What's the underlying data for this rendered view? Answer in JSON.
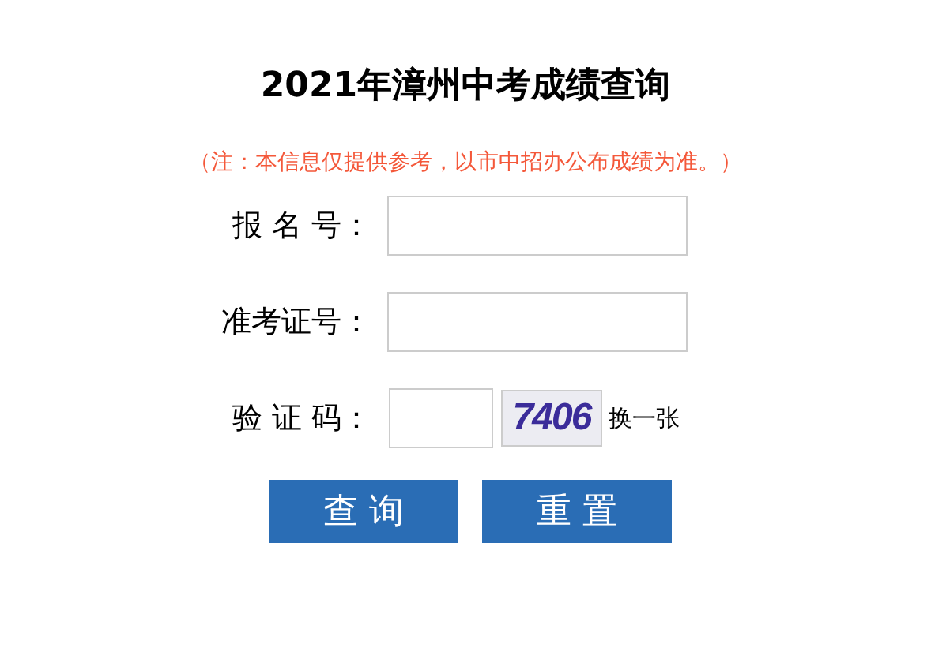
{
  "title": "2021年漳州中考成绩查询",
  "note": "（注：本信息仅提供参考，以市中招办公布成绩为准。）",
  "fields": [
    {
      "kind": "text",
      "label": "报 名 号："
    },
    {
      "kind": "text",
      "label": "准考证号："
    },
    {
      "kind": "captcha",
      "label": "验 证 码：",
      "captcha": "7406",
      "refresh": "换一张"
    }
  ],
  "buttons": [
    "查 询",
    "重 置"
  ]
}
